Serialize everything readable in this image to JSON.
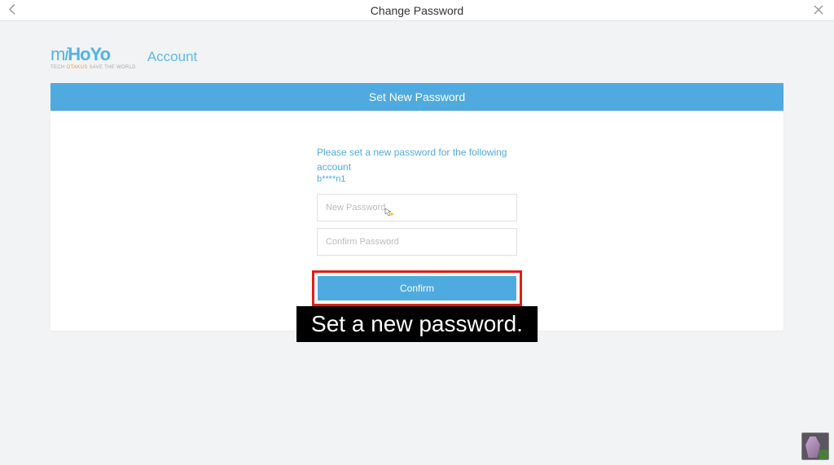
{
  "header": {
    "title": "Change Password"
  },
  "logo": {
    "text_account": "Account"
  },
  "banner": {
    "title": "Set New Password"
  },
  "form": {
    "instruction": "Please set a new password for the following account",
    "username": "b****n1",
    "new_password_placeholder": "New Password",
    "confirm_password_placeholder": "Confirm Password",
    "confirm_button": "Confirm"
  },
  "caption": "Set a new password."
}
